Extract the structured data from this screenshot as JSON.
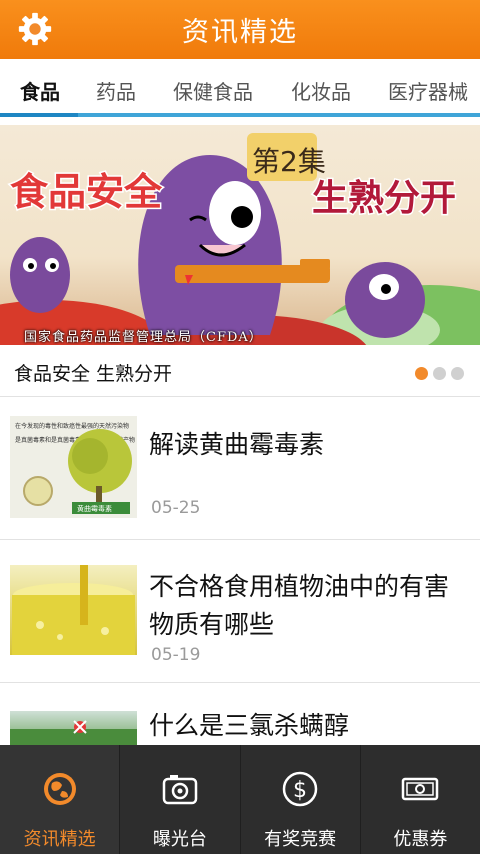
{
  "header": {
    "title": "资讯精选",
    "settings_icon": "gear-icon"
  },
  "tabs": [
    {
      "label": "食品",
      "active": true
    },
    {
      "label": "药品",
      "active": false
    },
    {
      "label": "保健食品",
      "active": false
    },
    {
      "label": "化妆品",
      "active": false
    },
    {
      "label": "医疗器械",
      "active": false
    }
  ],
  "banner": {
    "headline_left": "食品安全",
    "episode": "第2集",
    "headline_right": "生熟分开",
    "credit": "国家食品药品监督管理总局（CFDA）",
    "caption": "食品安全 生熟分开",
    "slide_count": 3,
    "active_slide": 1
  },
  "news": [
    {
      "title": "解读黄曲霉毒素",
      "date": "05-25",
      "thumb_caption": "黄曲霉毒素",
      "thumb_text": "在今发现的毒性和致癌性最强的天然污染物",
      "thumb_text2": "是真菌毒素和是真菌毒素种产生剂农业代产物"
    },
    {
      "title": "不合格食用植物油中的有害物质有哪些",
      "date": "05-19"
    },
    {
      "title": "什么是三氯杀螨醇",
      "date": ""
    }
  ],
  "bottom_nav": [
    {
      "label": "资讯精选",
      "icon": "globe-icon",
      "active": true
    },
    {
      "label": "曝光台",
      "icon": "camera-icon",
      "active": false
    },
    {
      "label": "有奖竞赛",
      "icon": "dollar-icon",
      "active": false
    },
    {
      "label": "优惠券",
      "icon": "coupon-icon",
      "active": false
    }
  ],
  "colors": {
    "brand_orange": "#f28a2b",
    "tab_blue": "#1e86c3",
    "nav_bg": "#2d2d2d"
  }
}
